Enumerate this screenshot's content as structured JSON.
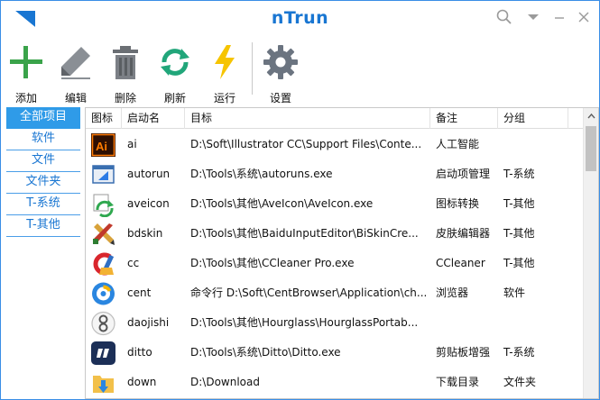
{
  "window": {
    "title": "nTrun"
  },
  "toolbar": {
    "add_label": "添加",
    "edit_label": "编辑",
    "delete_label": "删除",
    "refresh_label": "刷新",
    "run_label": "运行",
    "settings_label": "设置"
  },
  "sidebar": {
    "items": [
      {
        "label": "全部项目",
        "active": true
      },
      {
        "label": "软件"
      },
      {
        "label": "文件"
      },
      {
        "label": "文件夹"
      },
      {
        "label": "T-系统"
      },
      {
        "label": "T-其他"
      }
    ]
  },
  "list": {
    "columns": {
      "icon": "图标",
      "name": "启动名",
      "target": "目标",
      "note": "备注",
      "group": "分组"
    },
    "rows": [
      {
        "icon": "illustrator-icon",
        "name": "ai",
        "target": "D:\\Soft\\Illustrator CC\\Support Files\\Conte...",
        "note": "人工智能",
        "group": ""
      },
      {
        "icon": "autoruns-icon",
        "name": "autorun",
        "target": "D:\\Tools\\系统\\autoruns.exe",
        "note": "启动项管理",
        "group": "T-系统"
      },
      {
        "icon": "aveicon-icon",
        "name": "aveicon",
        "target": "D:\\Tools\\其他\\AveIcon\\AveIcon.exe",
        "note": "图标转换",
        "group": "T-其他"
      },
      {
        "icon": "bdskin-icon",
        "name": "bdskin",
        "target": "D:\\Tools\\其他\\BaiduInputEditor\\BiSkinCre...",
        "note": "皮肤编辑器",
        "group": "T-其他"
      },
      {
        "icon": "ccleaner-icon",
        "name": "cc",
        "target": "D:\\Tools\\其他\\CCleaner Pro.exe",
        "note": "CCleaner",
        "group": "T-其他"
      },
      {
        "icon": "centbrowser-icon",
        "name": "cent",
        "target": "命令行 D:\\Soft\\CentBrowser\\Application\\ch...",
        "note": "浏览器",
        "group": "软件"
      },
      {
        "icon": "hourglass-icon",
        "name": "daojishi",
        "target": "D:\\Tools\\其他\\Hourglass\\HourglassPortab...",
        "note": "",
        "group": ""
      },
      {
        "icon": "ditto-icon",
        "name": "ditto",
        "target": "D:\\Tools\\系统\\Ditto\\Ditto.exe",
        "note": "剪贴板增强",
        "group": "T-系统"
      },
      {
        "icon": "download-folder-icon",
        "name": "down",
        "target": "D:\\Download",
        "note": "下载目录",
        "group": "文件夹"
      }
    ]
  },
  "colors": {
    "accent": "#2f9be8",
    "title": "#1976d2",
    "border": "#3a8ee6"
  }
}
